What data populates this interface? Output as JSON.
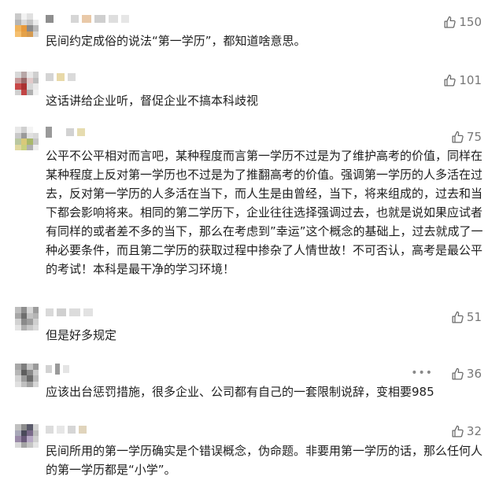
{
  "comments": [
    {
      "text": "民间约定成俗的说法“第一学历”，都知道啥意思。",
      "likes": "150",
      "liked_icon": "thumbs-up-icon"
    },
    {
      "text": "这话讲给企业听，督促企业不搞本科歧视",
      "likes": "101",
      "liked_icon": "thumbs-up-icon"
    },
    {
      "text": "公平不公平相对而言吧，某种程度而言第一学历不过是为了维护高考的价值，同样在某种程度上反对第一学历也不过是为了推翻高考的价值。强调第一学历的人多活在过去，反对第一学历的人多活在当下，而人生是由曾经，当下，将来组成的，过去和当下都会影响将来。相同的第二学历下，企业往往选择强调过去，也就是说如果应试者有同样的或者差不多的当下，那么在考虑到”幸运”这个概念的基础上，过去就成了一种必要条件，而且第二学历的获取过程中掺杂了人情世故！不可否认，高考是最公平的考试！本科是最干净的学习环境！",
      "likes": "75",
      "liked_icon": "thumbs-up-icon"
    },
    {
      "text": "但是好多规定",
      "likes": "51",
      "liked_icon": "thumbs-up-icon"
    },
    {
      "text": "应该出台惩罚措施，很多企业、公司都有自己的一套限制说辞，变相要985",
      "likes": "36",
      "liked_icon": "thumbs-up-icon",
      "more_label": "•••"
    },
    {
      "text": "民间所用的第一学历确实是个错误概念，伪命题。非要用第一学历的话，那么任何人的第一学历都是“小学”。",
      "likes": "32",
      "liked_icon": "thumbs-up-icon"
    }
  ]
}
